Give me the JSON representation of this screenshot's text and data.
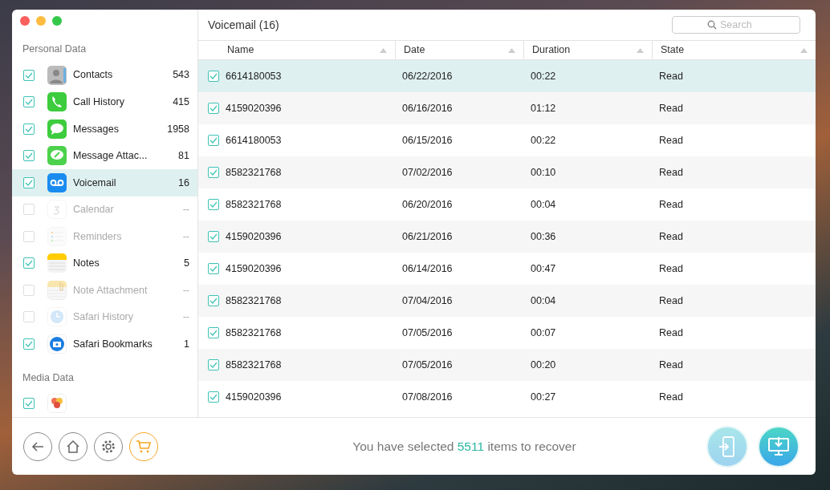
{
  "sidebar": {
    "sections": [
      {
        "title": "Personal Data",
        "items": [
          {
            "label": "Contacts",
            "count": "543",
            "checked": true,
            "disabled": false,
            "selected": false
          },
          {
            "label": "Call History",
            "count": "415",
            "checked": true,
            "disabled": false,
            "selected": false
          },
          {
            "label": "Messages",
            "count": "1958",
            "checked": true,
            "disabled": false,
            "selected": false
          },
          {
            "label": "Message Attac...",
            "count": "81",
            "checked": true,
            "disabled": false,
            "selected": false
          },
          {
            "label": "Voicemail",
            "count": "16",
            "checked": true,
            "disabled": false,
            "selected": true
          },
          {
            "label": "Calendar",
            "count": "--",
            "checked": false,
            "disabled": true,
            "selected": false
          },
          {
            "label": "Reminders",
            "count": "--",
            "checked": false,
            "disabled": true,
            "selected": false
          },
          {
            "label": "Notes",
            "count": "5",
            "checked": true,
            "disabled": false,
            "selected": false
          },
          {
            "label": "Note Attachment",
            "count": "--",
            "checked": false,
            "disabled": true,
            "selected": false
          },
          {
            "label": "Safari History",
            "count": "--",
            "checked": false,
            "disabled": true,
            "selected": false
          },
          {
            "label": "Safari Bookmarks",
            "count": "1",
            "checked": true,
            "disabled": false,
            "selected": false
          }
        ]
      },
      {
        "title": "Media Data",
        "items": [
          {
            "checked": true,
            "disabled": false,
            "selected": false
          }
        ]
      }
    ]
  },
  "header": {
    "title": "Voicemail (16)",
    "search": {
      "placeholder": "Search"
    }
  },
  "table": {
    "columns": [
      "Name",
      "Date",
      "Duration",
      "State"
    ],
    "rows": [
      {
        "checked": true,
        "selected": true,
        "cells": [
          "6614180053",
          "06/22/2016",
          "00:22",
          "Read"
        ]
      },
      {
        "checked": true,
        "selected": false,
        "cells": [
          "4159020396",
          "06/16/2016",
          "01:12",
          "Read"
        ]
      },
      {
        "checked": true,
        "selected": false,
        "cells": [
          "6614180053",
          "06/15/2016",
          "00:22",
          "Read"
        ]
      },
      {
        "checked": true,
        "selected": false,
        "cells": [
          "8582321768",
          "07/02/2016",
          "00:10",
          "Read"
        ]
      },
      {
        "checked": true,
        "selected": false,
        "cells": [
          "8582321768",
          "06/20/2016",
          "00:04",
          "Read"
        ]
      },
      {
        "checked": true,
        "selected": false,
        "cells": [
          "4159020396",
          "06/21/2016",
          "00:36",
          "Read"
        ]
      },
      {
        "checked": true,
        "selected": false,
        "cells": [
          "4159020396",
          "06/14/2016",
          "00:47",
          "Read"
        ]
      },
      {
        "checked": true,
        "selected": false,
        "cells": [
          "8582321768",
          "07/04/2016",
          "00:04",
          "Read"
        ]
      },
      {
        "checked": true,
        "selected": false,
        "cells": [
          "8582321768",
          "07/05/2016",
          "00:07",
          "Read"
        ]
      },
      {
        "checked": true,
        "selected": false,
        "cells": [
          "8582321768",
          "07/05/2016",
          "00:20",
          "Read"
        ]
      },
      {
        "checked": true,
        "selected": false,
        "cells": [
          "4159020396",
          "07/08/2016",
          "00:27",
          "Read"
        ]
      }
    ]
  },
  "footer": {
    "prefix": "You have selected",
    "count": "5511",
    "suffix": "items to recover"
  }
}
